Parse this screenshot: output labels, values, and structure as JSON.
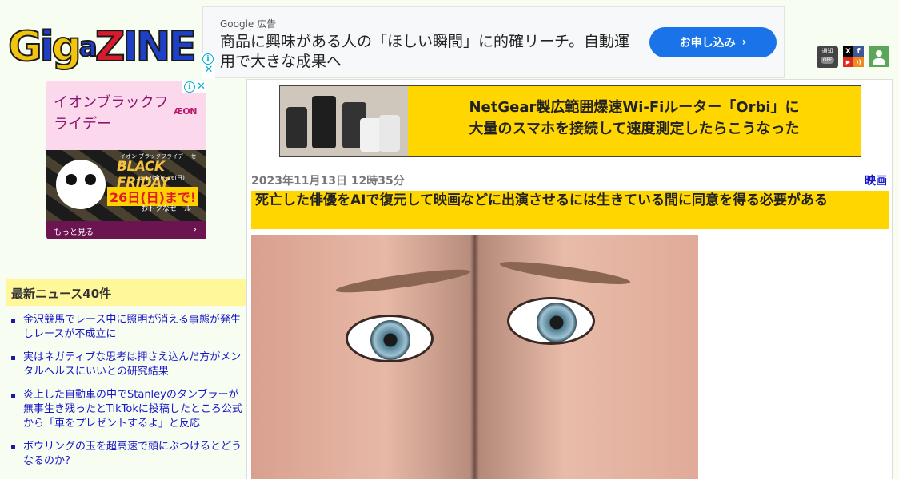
{
  "logo": {
    "g1": "G",
    "i1": "i",
    "g2": "g",
    "a": "a",
    "z": "Z",
    "i2": "I",
    "n": "N",
    "e": "E"
  },
  "top_ad": {
    "source": "Google 広告",
    "headline": "商品に興味がある人の「ほしい瞬間」に的確リーチ。自動運用で大きな成果へ",
    "cta": "お申し込み",
    "cta_arrow": "›"
  },
  "header_icons": {
    "notify_label": "通知",
    "notify_state": "OFF",
    "social": [
      "X",
      "f",
      "▶",
      "))"
    ],
    "user": "user-icon"
  },
  "side_ad": {
    "title": "イオンブラックフライデー",
    "brand": "ÆON",
    "banner_top": "イオン ブラックフライデー セール",
    "banner_main": "BLACK FRIDAY",
    "banner_date": "11.17(金)〜26(日)",
    "banner_until": "26日(日)まで!",
    "banner_sale": "おトクなセール",
    "more": "もっと見る",
    "more_arrow": "›",
    "adchoice_i": "i",
    "adchoice_x": "✕"
  },
  "news": {
    "heading": "最新ニュース40件",
    "items": [
      "金沢競馬でレース中に照明が消える事態が発生しレースが不成立に",
      "実はネガティブな思考は押さえ込んだ方がメンタルヘルスにいいとの研究結果",
      "炎上した自動車の中でStanleyのタンブラーが無事生き残ったとTikTokに投稿したところ公式から「車をプレゼントするよ」と反応",
      "ボウリングの玉を超高速で頭にぶつけるとどうなるのか?"
    ]
  },
  "promo": {
    "line1": "NetGear製広範囲爆速Wi-Fiルーター「Orbi」に",
    "line2": "大量のスマホを接続して速度測定したらこうなった"
  },
  "article": {
    "date": "2023年11月13日 12時35分",
    "category": "映画",
    "title": "死亡した俳優をAIで復元して映画などに出演させるには生きている間に同意を得る必要がある"
  },
  "colors": {
    "background": "#f8fdf1",
    "accent_yellow": "#ffd600",
    "news_heading_bg": "#fff799",
    "link_blue": "#1515c8",
    "cta_blue": "#1a73e8"
  }
}
